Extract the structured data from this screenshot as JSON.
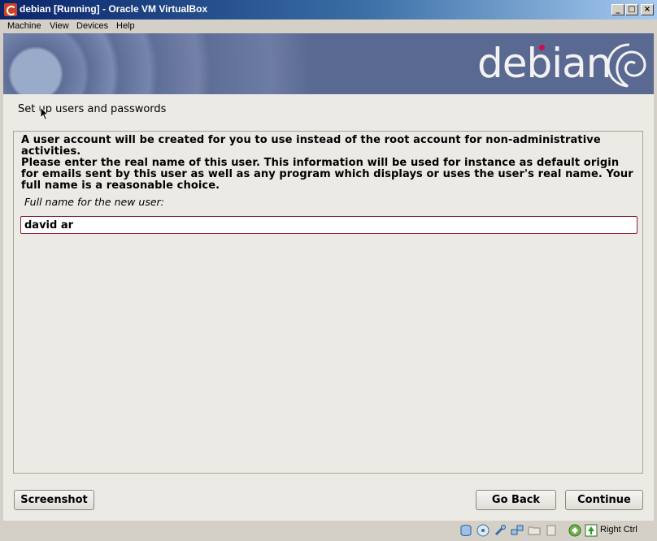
{
  "window": {
    "title": "debian [Running] - Oracle VM VirtualBox",
    "minimize": "_",
    "maximize": "□",
    "close": "×"
  },
  "menu": {
    "items": [
      "Machine",
      "View",
      "Devices",
      "Help"
    ]
  },
  "installer": {
    "logo_text": "debian",
    "section_title": "Set up users and passwords",
    "intro": "A user account will be created for you to use instead of the root account for non-administrative activities.",
    "instructions": "Please enter the real name of this user. This information will be used for instance as default origin for emails sent by this user as well as any program which displays or uses the user's real name. Your full name is a reasonable choice.",
    "field_label": "Full name for the new user:",
    "field_value": "david ar",
    "buttons": {
      "screenshot": "Screenshot",
      "go_back": "Go Back",
      "continue": "Continue"
    }
  },
  "statusbar": {
    "host_key": "Right Ctrl",
    "icons": [
      "hard-disk-icon",
      "optical-drive-icon",
      "usb-icon",
      "network-icon",
      "shared-folder-icon",
      "display-icon",
      "virtualization-icon",
      "mouse-integration-icon"
    ]
  },
  "colors": {
    "banner": "#5f6e96",
    "debian_red": "#d70751",
    "input_border": "#8e1f3c",
    "title_bar": "#0a246a"
  }
}
